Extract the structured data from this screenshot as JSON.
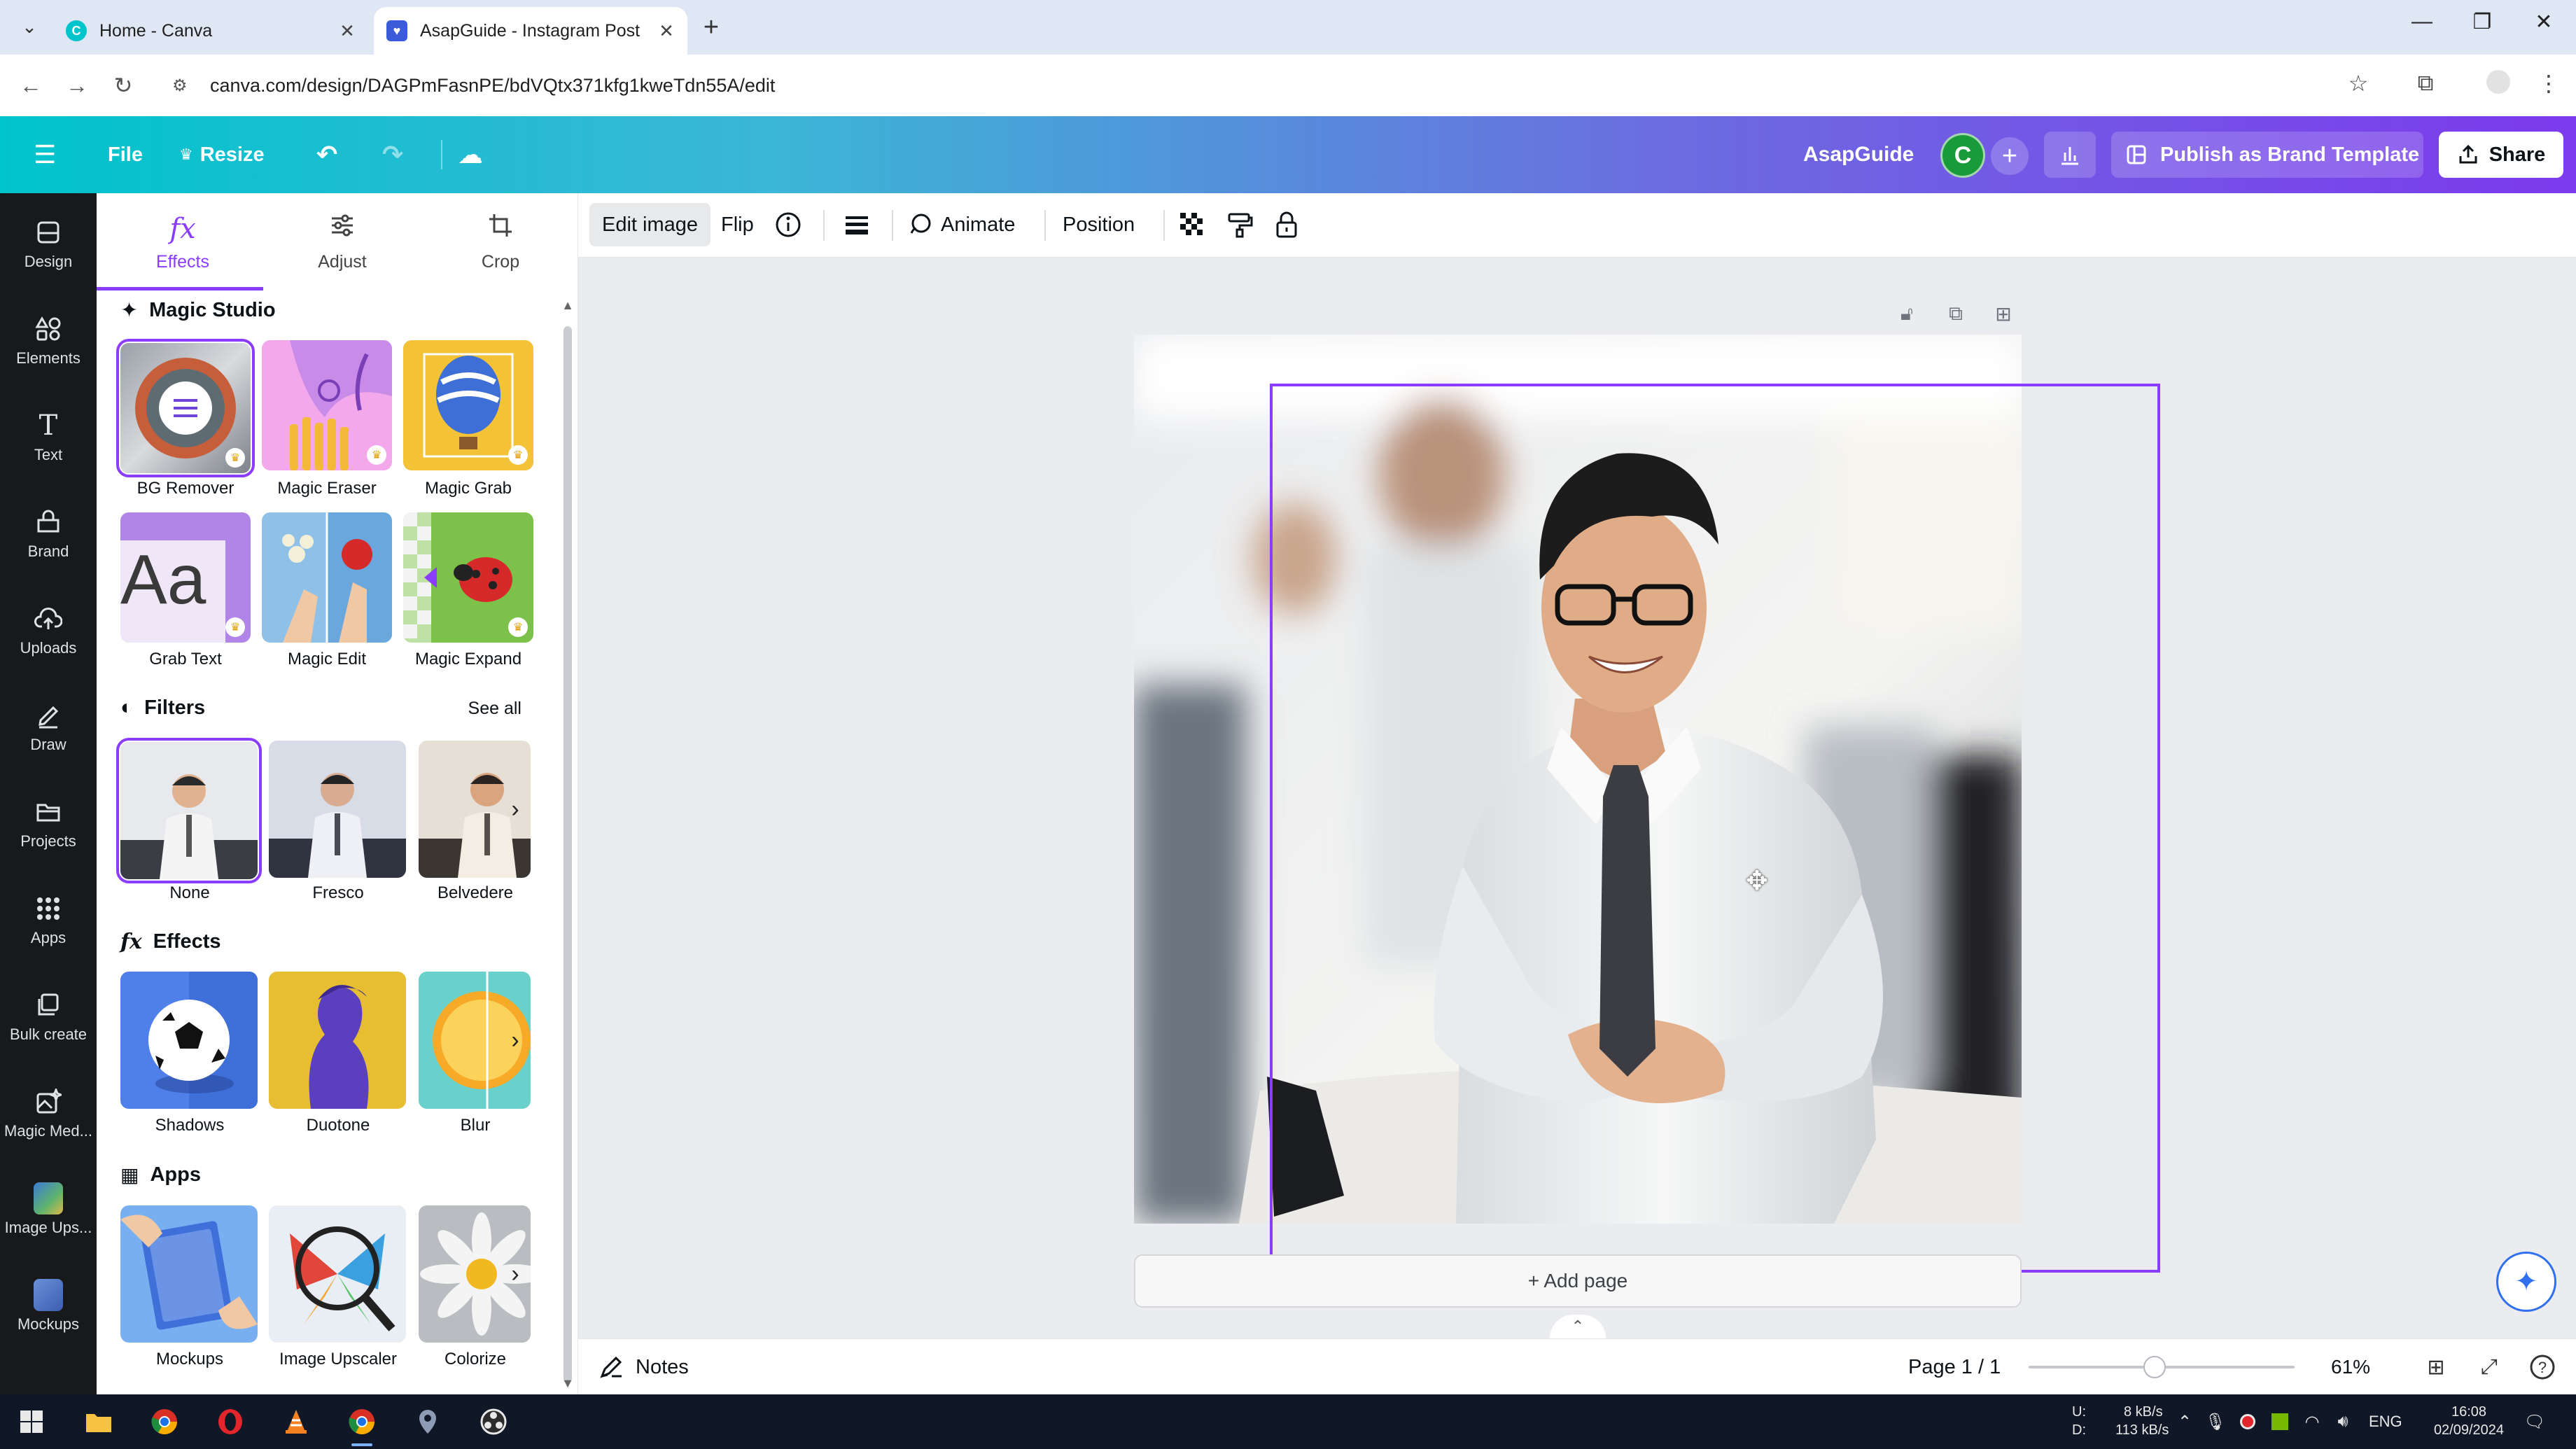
{
  "browser": {
    "tabs": [
      {
        "title": "Home - Canva",
        "active": false
      },
      {
        "title": "AsapGuide - Instagram Post",
        "active": true
      }
    ],
    "new_tab": "+",
    "url": "canva.com/design/DAGPmFasnPE/bdVQtx371kfg1kweTdn55A/edit"
  },
  "header": {
    "file": "File",
    "resize": "Resize",
    "brand_name": "AsapGuide",
    "avatar_letter": "C",
    "publish": "Publish as Brand Template",
    "share": "Share"
  },
  "rail": {
    "items": [
      {
        "label": "Design",
        "icon": "design-icon"
      },
      {
        "label": "Elements",
        "icon": "elements-icon"
      },
      {
        "label": "Text",
        "icon": "text-icon"
      },
      {
        "label": "Brand",
        "icon": "brand-icon"
      },
      {
        "label": "Uploads",
        "icon": "uploads-icon"
      },
      {
        "label": "Draw",
        "icon": "draw-icon"
      },
      {
        "label": "Projects",
        "icon": "projects-icon"
      },
      {
        "label": "Apps",
        "icon": "apps-icon"
      },
      {
        "label": "Bulk create",
        "icon": "bulk-create-icon"
      },
      {
        "label": "Magic Med...",
        "icon": "magic-media-icon"
      },
      {
        "label": "Image Ups...",
        "icon": "image-upscaler-icon"
      },
      {
        "label": "Mockups",
        "icon": "mockups-icon"
      }
    ]
  },
  "panel": {
    "tabs": [
      {
        "label": "Effects",
        "icon": "fx"
      },
      {
        "label": "Adjust",
        "icon": "adjust-icon"
      },
      {
        "label": "Crop",
        "icon": "crop-icon"
      }
    ],
    "magic_studio": {
      "title": "Magic Studio",
      "items": [
        "BG Remover",
        "Magic Eraser",
        "Magic Grab",
        "Grab Text",
        "Magic Edit",
        "Magic Expand"
      ]
    },
    "filters": {
      "title": "Filters",
      "see_all": "See all",
      "items": [
        "None",
        "Fresco",
        "Belvedere"
      ]
    },
    "effects": {
      "title": "Effects",
      "items": [
        "Shadows",
        "Duotone",
        "Blur"
      ]
    },
    "apps": {
      "title": "Apps",
      "items": [
        "Mockups",
        "Image Upscaler",
        "Colorize"
      ]
    }
  },
  "toolbar": {
    "edit_image": "Edit image",
    "flip": "Flip",
    "animate": "Animate",
    "position": "Position"
  },
  "canvas": {
    "add_page": "+ Add page"
  },
  "footer": {
    "notes": "Notes",
    "page_indicator": "Page 1 / 1",
    "zoom": "61%",
    "zoom_level": 0.61
  },
  "taskbar": {
    "net_up_label": "U:",
    "net_down_label": "D:",
    "net_up": "8 kB/s",
    "net_down": "113 kB/s",
    "lang": "ENG",
    "time": "16:08",
    "date": "02/09/2024"
  },
  "colors": {
    "accent": "#8b3dff",
    "header_start": "#00c4cc",
    "header_end": "#7c3aed",
    "rail_bg": "#18191b"
  }
}
